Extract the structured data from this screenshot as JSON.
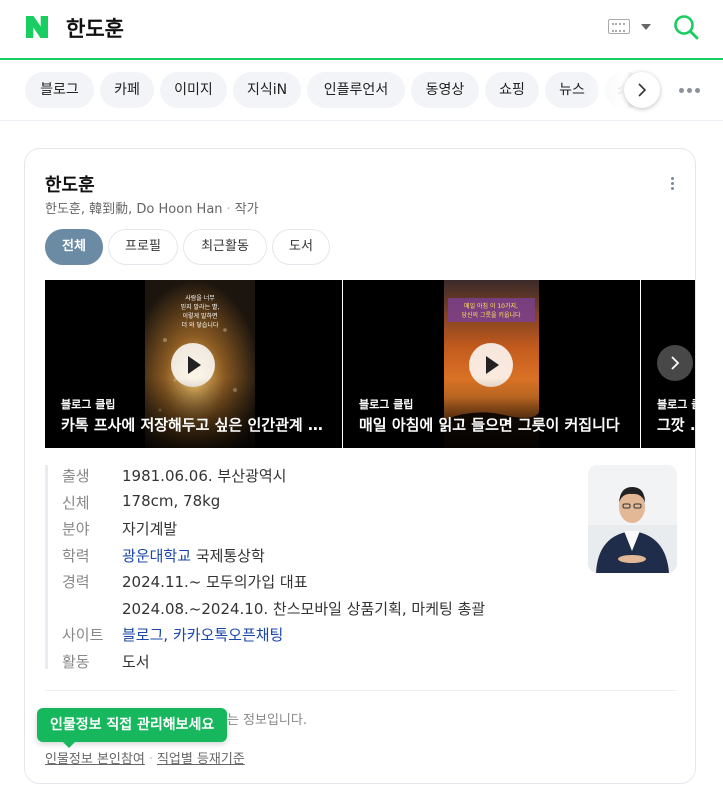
{
  "search": {
    "query": "한도훈"
  },
  "colors": {
    "brand": "#19ce60",
    "accent": "#6b8aa3",
    "link": "#1a47a8",
    "tooltip": "#17b75e"
  },
  "tabs": [
    {
      "label": "블로그"
    },
    {
      "label": "카페"
    },
    {
      "label": "이미지"
    },
    {
      "label": "지식iN"
    },
    {
      "label": "인플루언서"
    },
    {
      "label": "동영상"
    },
    {
      "label": "쇼핑"
    },
    {
      "label": "뉴스"
    },
    {
      "label": "쇼"
    }
  ],
  "profile": {
    "name": "한도훈",
    "aliases": "한도훈, 韓到勳, Do Hoon Han",
    "occupation": "작가",
    "subtabs": [
      {
        "label": "전체"
      },
      {
        "label": "프로필"
      },
      {
        "label": "최근활동"
      },
      {
        "label": "도서"
      }
    ],
    "videos": [
      {
        "source": "블로그 클립",
        "title": "카톡 프사에 저장해두고 싶은 인간관계 명언"
      },
      {
        "source": "블로그 클립",
        "title": "매일 아침에 읽고 들으면 그릇이 커집니다"
      },
      {
        "source": "블로그 클립",
        "title": "그깟 ..."
      }
    ],
    "video_overlays": [
      {
        "text": "사람을 너무\n믿지 말라는 말,\n이렇게 말하면\n더 와 닿습니다"
      },
      {
        "text": "매일 아침 이 10가지,\n당신의 그릇을 키웁니다"
      }
    ],
    "info": {
      "birth_label": "출생",
      "birth_value": "1981.06.06. 부산광역시",
      "body_label": "신체",
      "body_value": "178cm, 78kg",
      "field_label": "분야",
      "field_value": "자기계발",
      "edu_label": "학력",
      "edu_school": "광운대학교",
      "edu_major": " 국제통상학",
      "career_label": "경력",
      "career_1": "2024.11.~ 모두의가입 대표",
      "career_2": "2024.08.~2024.10. 찬스모바일 상품기획, 마케팅 총괄",
      "site_label": "사이트",
      "site_blog": "블로그",
      "site_sep": ", ",
      "site_kakao": "카카오톡오픈채팅",
      "activity_label": "활동",
      "activity_value": "도서"
    },
    "notice": "인물정보 직접 관리해보세요 하는 정보입니다.",
    "notice_visible": "하는 정보입니다.",
    "tooltip": "인물정보 직접 관리해보세요",
    "footer": {
      "link1": "인물정보 본인참여",
      "link2": "직업별 등재기준"
    }
  }
}
